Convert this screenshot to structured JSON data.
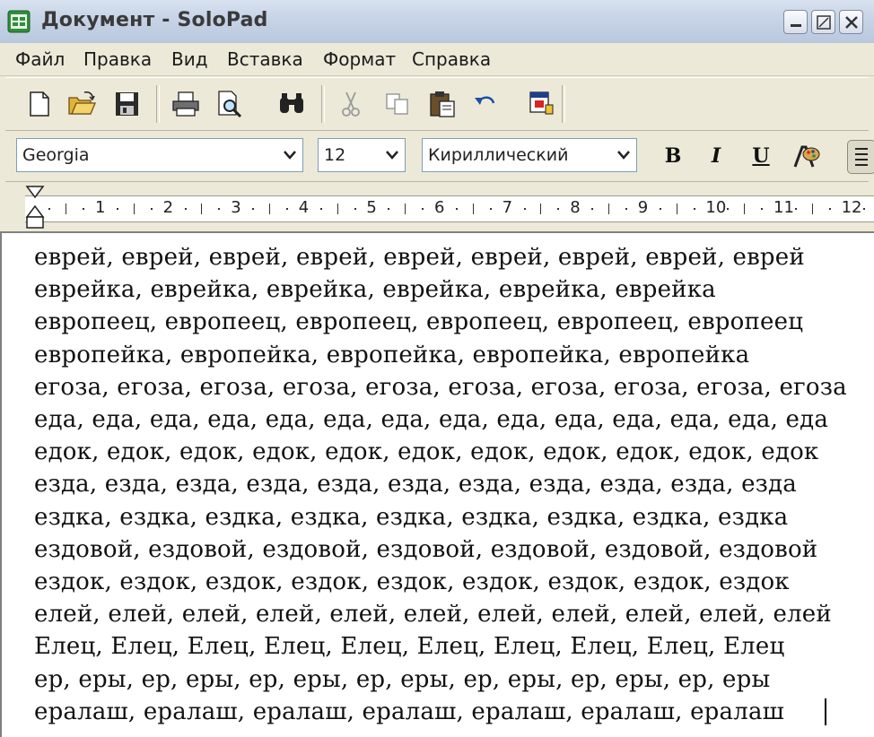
{
  "window": {
    "title": "Документ - SoloPad",
    "controls": [
      "minimize",
      "maximize",
      "close"
    ]
  },
  "menu": {
    "items": [
      "Файл",
      "Правка",
      "Вид",
      "Вставка",
      "Формат",
      "Справка"
    ]
  },
  "toolbar": {
    "icons": [
      "new-document-icon",
      "open-folder-icon",
      "save-icon",
      "print-icon",
      "print-preview-icon",
      "find-icon",
      "cut-icon",
      "copy-icon",
      "paste-icon",
      "undo-icon",
      "insert-date-icon"
    ]
  },
  "format": {
    "font": "Georgia",
    "size": "12",
    "charset": "Кириллический",
    "bold_label": "B",
    "italic_label": "I",
    "underline_label": "U"
  },
  "ruler": {
    "numbers": [
      "1",
      "2",
      "3",
      "4",
      "5",
      "6",
      "7",
      "8",
      "9",
      "10",
      "11",
      "12"
    ]
  },
  "document": {
    "lines": [
      "еврей, еврей, еврей, еврей, еврей, еврей, еврей, еврей, еврей",
      "еврейка, еврейка, еврейка, еврейка, еврейка, еврейка",
      "европеец, европеец, европеец, европеец, европеец, европеец",
      "европейка, европейка, европейка, европейка, европейка",
      "егоза, егоза, егоза, егоза, егоза, егоза, егоза, егоза, егоза, егоза",
      "еда, еда, еда, еда, еда, еда, еда, еда, еда, еда, еда, еда, еда, еда",
      "едок, едок, едок, едок, едок, едок, едок, едок, едок, едок, едок",
      "езда, езда, езда, езда, езда, езда, езда, езда, езда, езда, езда",
      "ездка, ездка, ездка, ездка, ездка, ездка, ездка, ездка, ездка",
      "ездовой, ездовой, ездовой, ездовой, ездовой, ездовой, ездовой",
      "ездок, ездок, ездок, ездок, ездок, ездок, ездок, ездок, ездок",
      "елей, елей, елей, елей, елей, елей, елей, елей, елей, елей, елей",
      "Елец, Елец, Елец, Елец, Елец, Елец, Елец, Елец, Елец, Елец",
      "ер, еры, ер, еры, ер, еры, ер, еры, ер, еры, ер, еры, ер, еры",
      "ералаш, ералаш, ералаш, ералаш, ералаш, ералаш, ералаш"
    ]
  }
}
